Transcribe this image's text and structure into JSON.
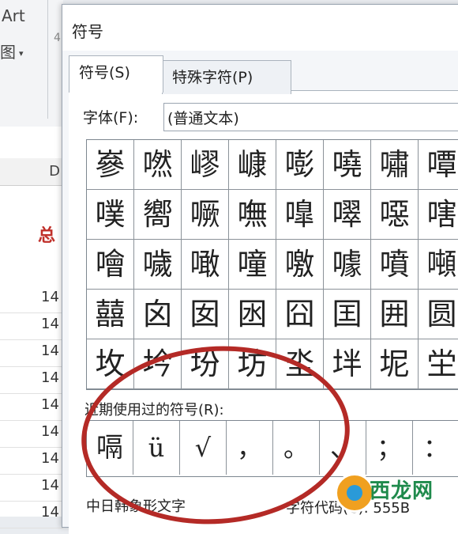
{
  "background": {
    "ribbon_art": "Art",
    "ribbon_tu": "图",
    "ribbon_caret": "▾",
    "ribbon_tiny": "4",
    "col_header": "D",
    "zong": "总",
    "rows": [
      "14",
      "14",
      "14",
      "14",
      "14",
      "14",
      "14",
      "14",
      "14"
    ]
  },
  "dialog": {
    "title": "符号",
    "tabs": [
      {
        "label": "符号(S)",
        "active": true
      },
      {
        "label": "特殊字符(P)",
        "active": false
      }
    ],
    "font_label": "字体(F):",
    "font_value": "(普通文本)",
    "symbols": [
      [
        "嵾",
        "嘫",
        "嵺",
        "嵻",
        "嘭",
        "嘵",
        "嘯",
        "嘾"
      ],
      [
        "噗",
        "嚮",
        "噘",
        "嘸",
        "嘷",
        "噿",
        "噁",
        "嗐"
      ],
      [
        "噲",
        "噦",
        "噉",
        "噇",
        "噭",
        "噱",
        "噴",
        "噸"
      ],
      [
        "囍",
        "囟",
        "囡",
        "囦",
        "囧",
        "囯",
        "囲",
        "圆"
      ],
      [
        "坆",
        "坅",
        "坋",
        "坊",
        "坔",
        "坢",
        "坭",
        "坣"
      ]
    ],
    "recent_label": "近期使用过的符号(R):",
    "recent": [
      "嗝",
      "ü",
      "√",
      "，",
      "。",
      "、",
      "；",
      "："
    ],
    "char_name": "中日韩象形文字",
    "char_code": "字符代码(C): 555B"
  },
  "watermark": {
    "text": "西龙网"
  }
}
